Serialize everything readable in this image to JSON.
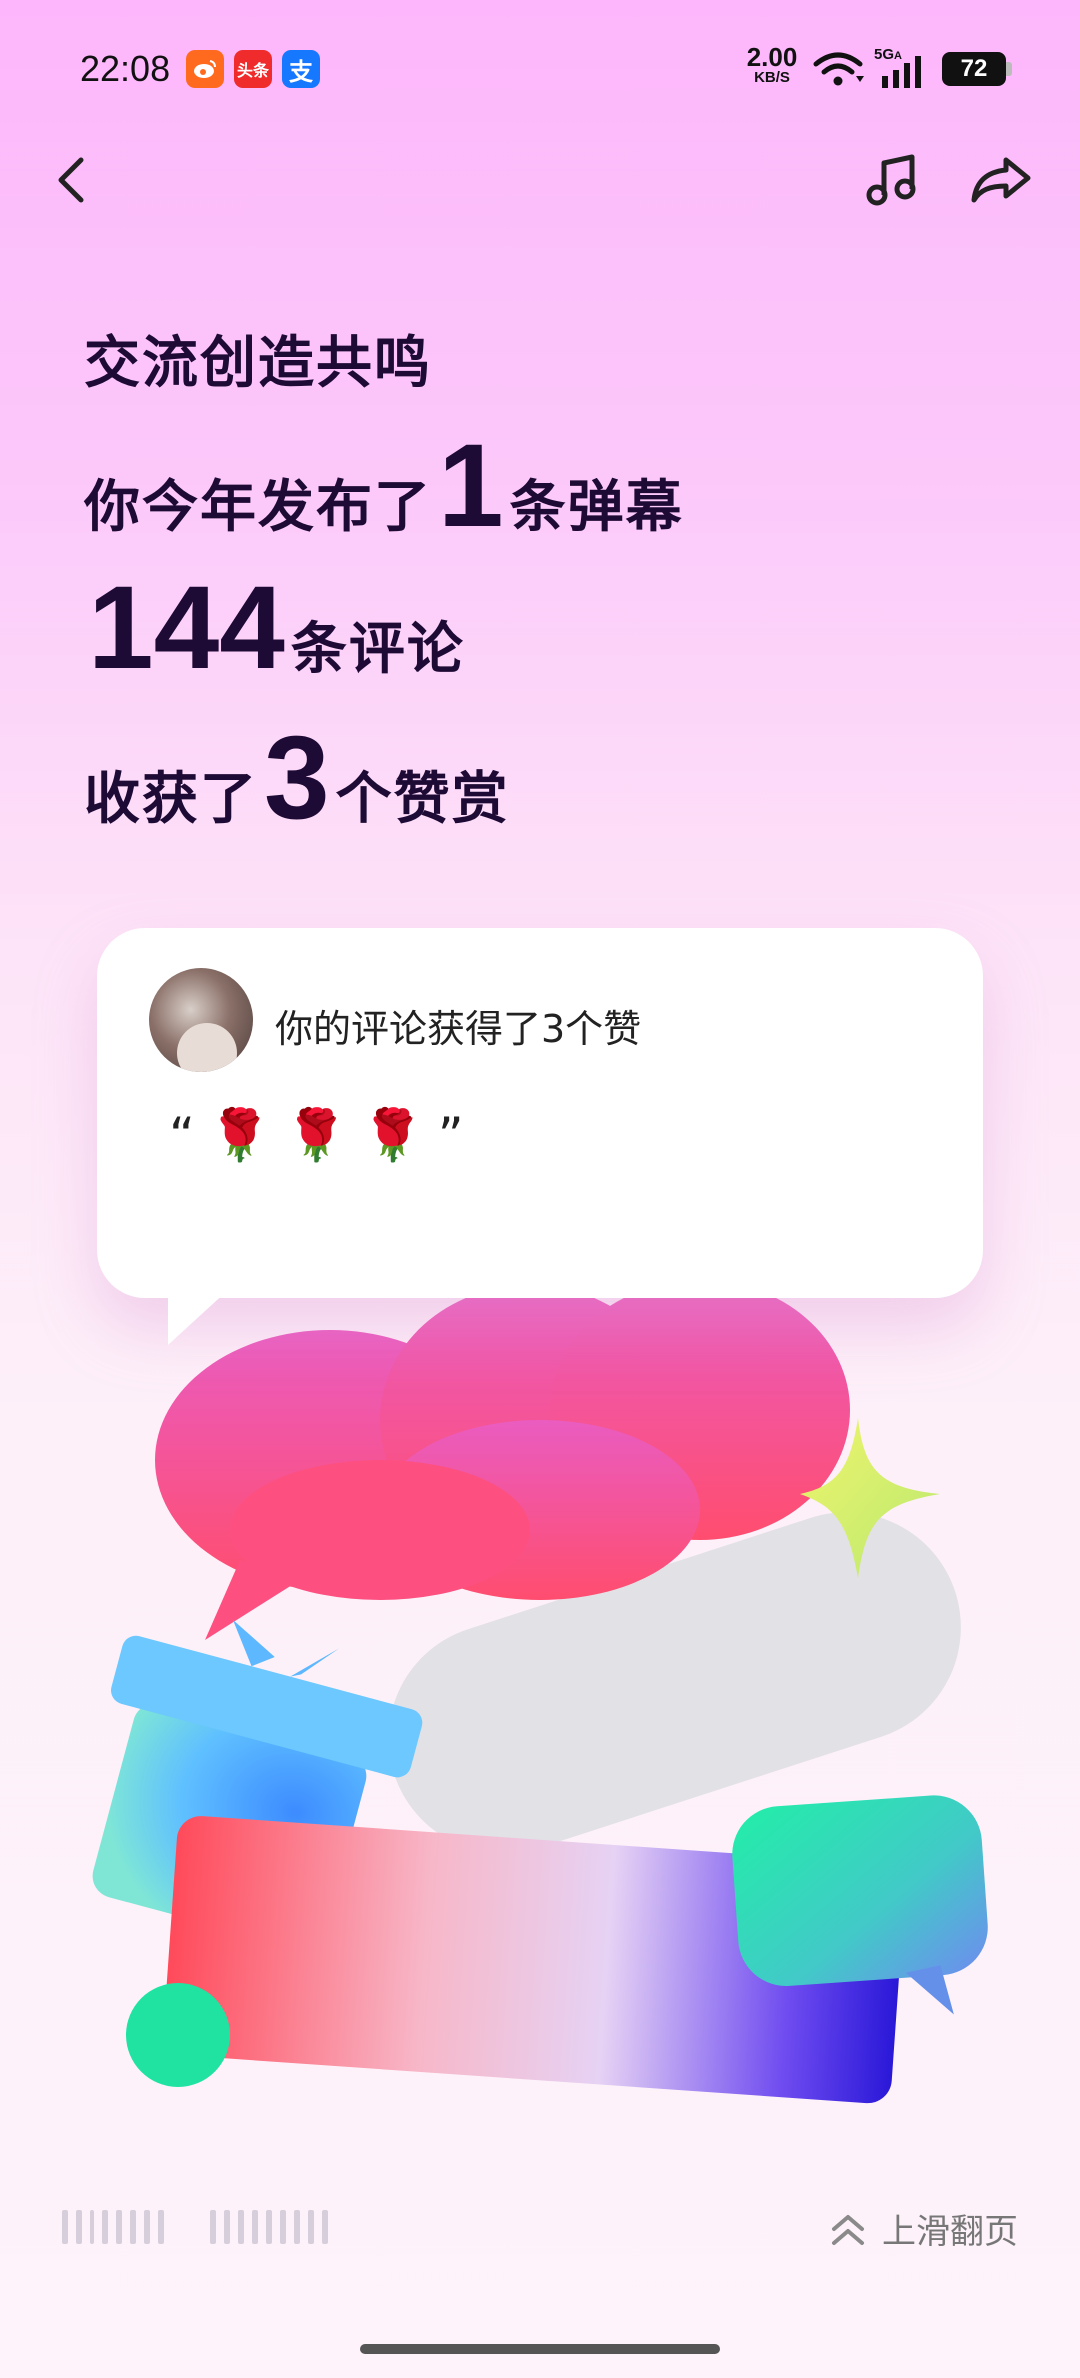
{
  "status_bar": {
    "time": "22:08",
    "app_icons": [
      {
        "name": "weibo-app-icon",
        "label": "",
        "color": "#ff5a1f"
      },
      {
        "name": "toutiao-app-icon",
        "label": "头条",
        "color": "#ef2b2b"
      },
      {
        "name": "alipay-app-icon",
        "label": "支",
        "color": "#1677ff"
      }
    ],
    "net_speed_value": "2.00",
    "net_speed_unit": "KB/S",
    "signal_label": "5G",
    "battery": "72"
  },
  "toolbar": {
    "back_icon": "back-arrow-icon",
    "music_icon": "music-note-icon",
    "share_icon": "share-arrow-icon"
  },
  "headline": {
    "line1": "交流创造共鸣",
    "line2_prefix": "你今年发布了",
    "danmaku_count": "1",
    "line2_suffix": "条弹幕",
    "comment_count": "144",
    "line3_suffix": "条评论",
    "line4_prefix": "收获了",
    "reward_count": "3",
    "line4_suffix": "个赞赏"
  },
  "comment_card": {
    "title": "你的评论获得了3个赞",
    "quote_open": "“",
    "quote_emojis": [
      "🌹",
      "🌹",
      "🌹"
    ],
    "quote_close": "”"
  },
  "footer": {
    "swipe_hint": "上滑翻页"
  },
  "colors": {
    "background_top": "#fdb6fb",
    "background_bottom": "#fef3fa",
    "headline": "#1e0b35",
    "bubble_pink": "#f25a8c",
    "gift_blue": "#58b4ff",
    "chat_green": "#2ee8a8"
  }
}
